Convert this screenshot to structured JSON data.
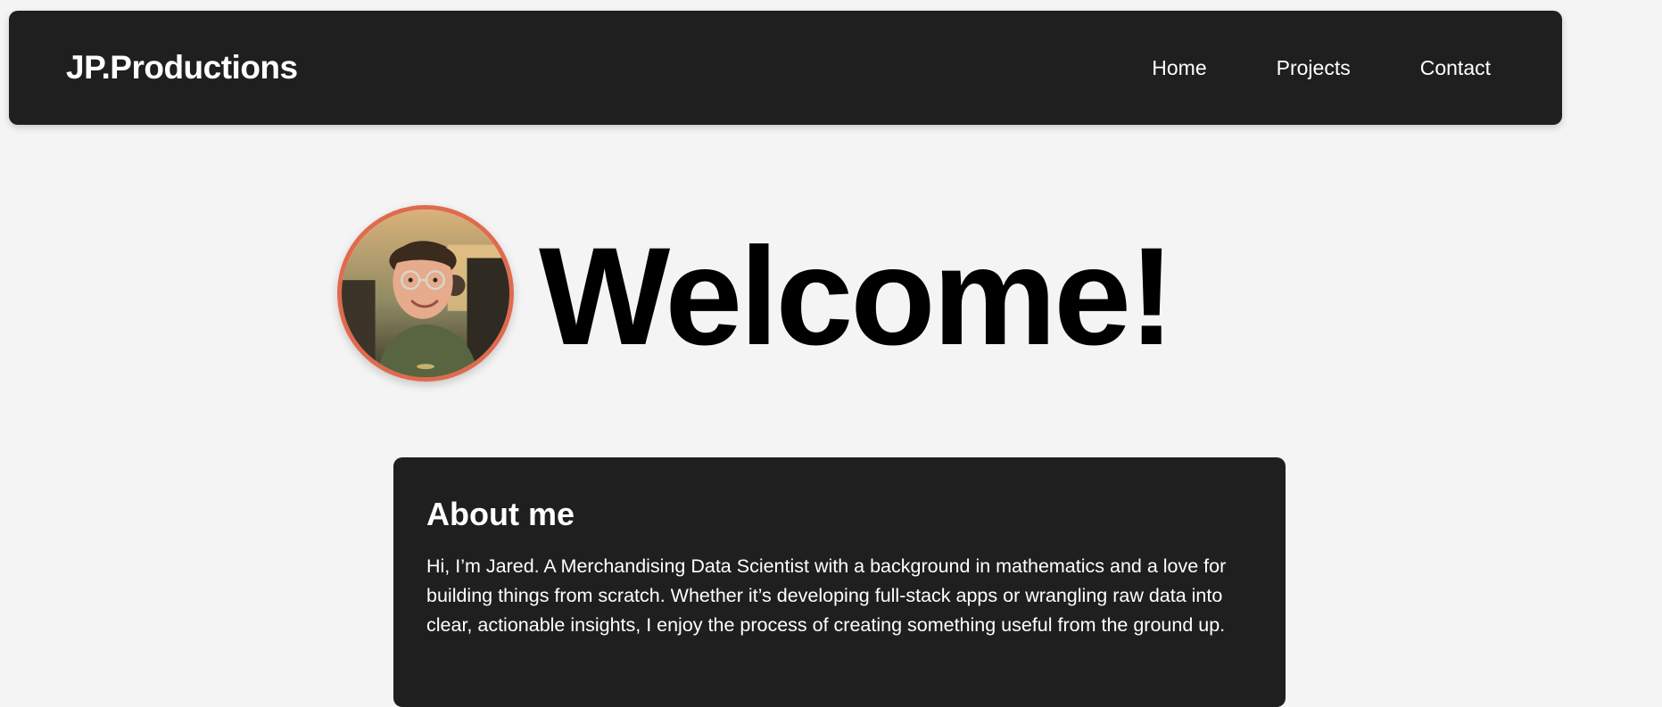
{
  "navbar": {
    "brand": "JP.Productions",
    "links": [
      {
        "label": "Home"
      },
      {
        "label": "Projects"
      },
      {
        "label": "Contact"
      }
    ]
  },
  "hero": {
    "title": "Welcome!",
    "avatar_icon": "profile-photo",
    "avatar_border_color": "#e06a4e"
  },
  "about": {
    "heading": "About me",
    "text": "Hi, I’m Jared. A Merchandising Data Scientist with a background in mathematics and a love for building things from scratch. Whether it’s developing full-stack apps or wrangling raw data into clear, actionable insights, I enjoy the process of creating something useful from the ground up."
  },
  "colors": {
    "background": "#f4f4f4",
    "panel": "#1f1f1f",
    "accent": "#e06a4e"
  }
}
